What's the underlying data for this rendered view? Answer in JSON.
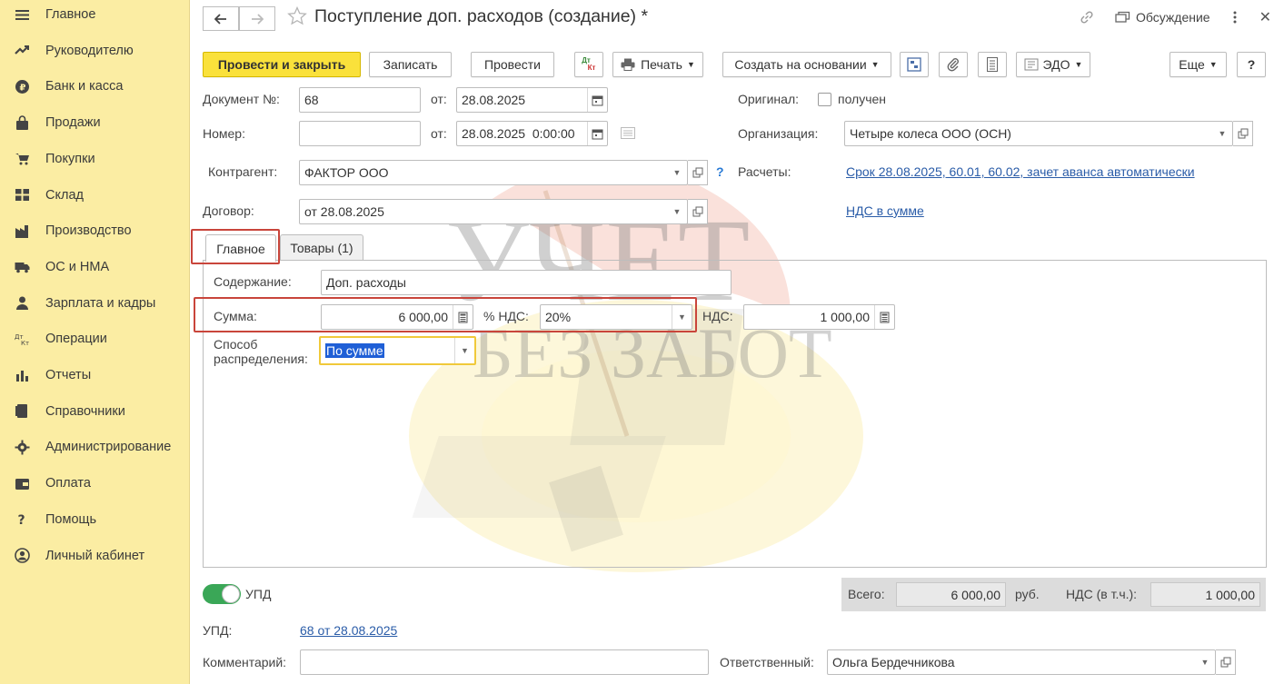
{
  "sidebar": {
    "items": [
      {
        "label": "Главное",
        "icon": "menu-icon"
      },
      {
        "label": "Руководителю",
        "icon": "trend-icon"
      },
      {
        "label": "Банк и касса",
        "icon": "coin-icon"
      },
      {
        "label": "Продажи",
        "icon": "bag-icon"
      },
      {
        "label": "Покупки",
        "icon": "cart-icon"
      },
      {
        "label": "Склад",
        "icon": "warehouse-icon"
      },
      {
        "label": "Производство",
        "icon": "factory-icon"
      },
      {
        "label": "ОС и НМА",
        "icon": "truck-icon"
      },
      {
        "label": "Зарплата и кадры",
        "icon": "person-icon"
      },
      {
        "label": "Операции",
        "icon": "dt-kt-icon"
      },
      {
        "label": "Отчеты",
        "icon": "bar-chart-icon"
      },
      {
        "label": "Справочники",
        "icon": "book-icon"
      },
      {
        "label": "Администрирование",
        "icon": "gear-icon"
      },
      {
        "label": "Оплата",
        "icon": "wallet-icon"
      },
      {
        "label": "Помощь",
        "icon": "question-icon"
      },
      {
        "label": "Личный кабинет",
        "icon": "user-circle-icon"
      }
    ]
  },
  "titlebar": {
    "title": "Поступление доп. расходов (создание) *",
    "discuss_label": "Обсуждение",
    "close_glyph": "✕"
  },
  "toolbar": {
    "post_close": "Провести и закрыть",
    "save": "Записать",
    "post": "Провести",
    "dtkt_top": "Дт",
    "dtkt_bottom": "Кт",
    "print": "Печать",
    "create_based": "Создать на основании",
    "edo": "ЭДО",
    "more": "Еще",
    "help": "?"
  },
  "form": {
    "doc_no_label": "Документ №:",
    "doc_no_value": "68",
    "from_label": "от:",
    "doc_date": "28.08.2025",
    "number_label": "Номер:",
    "number_value": "",
    "number_date": "28.08.2025  0:00:00",
    "counterparty_label": "Контрагент:",
    "counterparty_value": "ФАКТОР ООО",
    "counterparty_help": "?",
    "contract_label": "Договор:",
    "contract_value": "от 28.08.2025",
    "original_label": "Оригинал:",
    "original_checkbox_label": "получен",
    "org_label": "Организация:",
    "org_value": "Четыре колеса ООО (ОСН)",
    "settlements_label": "Расчеты:",
    "settlements_link": "Срок 28.08.2025, 60.01, 60.02, зачет аванса автоматически",
    "vat_link": "НДС в сумме"
  },
  "tabs": [
    {
      "label": "Главное",
      "active": true
    },
    {
      "label": "Товары (1)",
      "active": false
    }
  ],
  "main_tab": {
    "content_label": "Содержание:",
    "content_value": "Доп. расходы",
    "sum_label": "Сумма:",
    "sum_value": "6 000,00",
    "vat_rate_label": "% НДС:",
    "vat_rate_value": "20%",
    "vat_label": "НДС:",
    "vat_value": "1 000,00",
    "distribution_label_1": "Способ",
    "distribution_label_2": "распределения:",
    "distribution_value": "По сумме"
  },
  "watermark": {
    "line1": "УЧЕТ",
    "line2": "БЕЗ ЗАБОТ"
  },
  "footer": {
    "upd_toggle_label": "УПД",
    "upd_toggle_on": true,
    "total_label": "Всего:",
    "total_value": "6 000,00",
    "currency": "руб.",
    "vat_incl_label": "НДС (в т.ч.):",
    "vat_incl_value": "1 000,00",
    "upd_label": "УПД:",
    "upd_link": "68 от 28.08.2025",
    "comment_label": "Комментарий:",
    "comment_value": "",
    "responsible_label": "Ответственный:",
    "responsible_value": "Ольга Бердечникова"
  },
  "colors": {
    "sidebar_bg": "#FBEDA3",
    "primary_button": "#FAE13B",
    "link": "#2a5ca8",
    "highlight_box": "#c9453b",
    "toggle_on": "#3aa757",
    "selection": "#1f5fd6"
  }
}
